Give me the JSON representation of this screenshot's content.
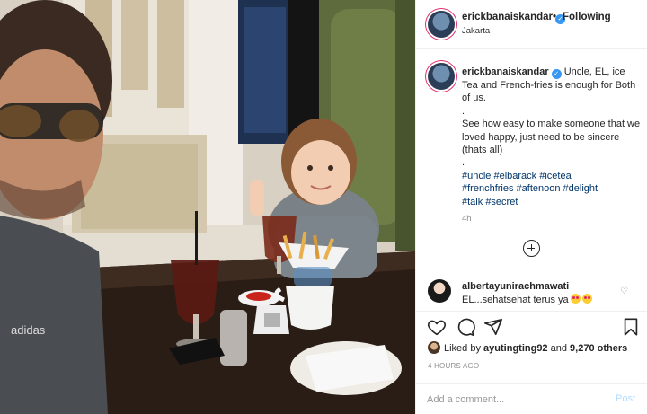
{
  "header": {
    "username": "erickbanaiskandar",
    "verified_mark": "✓",
    "location": "Jakarta",
    "separator": "•",
    "follow_state": "Following"
  },
  "caption": {
    "username": "erickbanaiskandar",
    "lines": [
      "Uncle, EL, ice Tea and French-fries is enough for Both of us.",
      ".",
      "See how easy to make someone that we loved happy, just need to be sincere (thats all)",
      "."
    ],
    "hashtags": [
      "#uncle",
      "#elbarack",
      "#icetea",
      "#frenchfries",
      "#aftenoon",
      "#delight",
      "#talk",
      "#secret"
    ],
    "time": "4h"
  },
  "comment": {
    "username": "albertayunirachmawati",
    "text": "EL...sehatsehat terus ya",
    "heart": "♡"
  },
  "likes": {
    "prefix": "Liked by",
    "user": "ayutingting92",
    "joiner": "and",
    "others": "9,270 others"
  },
  "posted_ago": "4 HOURS AGO",
  "add_comment": {
    "placeholder": "Add a comment...",
    "post_label": "Post"
  },
  "icons": [
    "verified-badge-icon",
    "more-comments-icon",
    "heart-icon",
    "comment-icon",
    "share-icon",
    "bookmark-icon"
  ],
  "colors": {
    "text": "#262626",
    "muted": "#8e8e8e",
    "link": "#003569",
    "verified": "#3897f0",
    "post_disabled": "#b3dbff",
    "border": "#efefef"
  }
}
